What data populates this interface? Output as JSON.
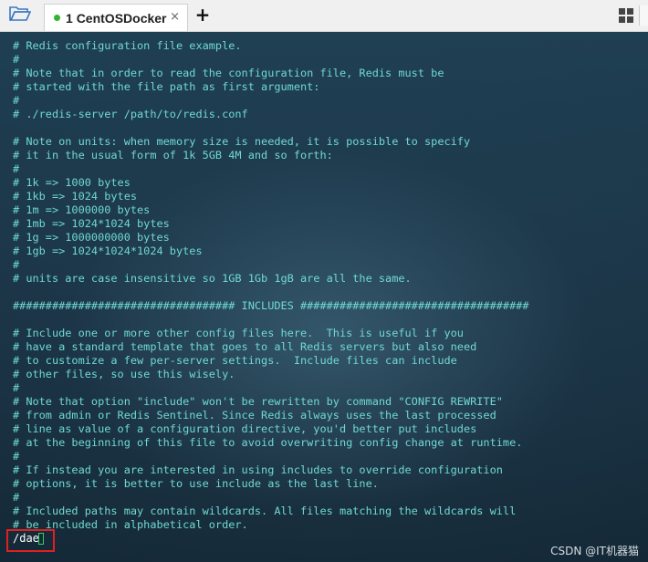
{
  "tabbar": {
    "folder_icon": "folder-open-icon",
    "tab": {
      "index": "1",
      "title": "CentOSDocker",
      "status_color": "#2fb52f"
    },
    "close_glyph": "×",
    "add_glyph": "+",
    "layout_icon": "grid-layout-icon"
  },
  "terminal": {
    "text_color": "#6fd9d2",
    "lines": [
      "# Redis configuration file example.",
      "#",
      "# Note that in order to read the configuration file, Redis must be",
      "# started with the file path as first argument:",
      "#",
      "# ./redis-server /path/to/redis.conf",
      "",
      "# Note on units: when memory size is needed, it is possible to specify",
      "# it in the usual form of 1k 5GB 4M and so forth:",
      "#",
      "# 1k => 1000 bytes",
      "# 1kb => 1024 bytes",
      "# 1m => 1000000 bytes",
      "# 1mb => 1024*1024 bytes",
      "# 1g => 1000000000 bytes",
      "# 1gb => 1024*1024*1024 bytes",
      "#",
      "# units are case insensitive so 1GB 1Gb 1gB are all the same.",
      "",
      "################################## INCLUDES ###################################",
      "",
      "# Include one or more other config files here.  This is useful if you",
      "# have a standard template that goes to all Redis servers but also need",
      "# to customize a few per-server settings.  Include files can include",
      "# other files, so use this wisely.",
      "#",
      "# Note that option \"include\" won't be rewritten by command \"CONFIG REWRITE\"",
      "# from admin or Redis Sentinel. Since Redis always uses the last processed",
      "# line as value of a configuration directive, you'd better put includes",
      "# at the beginning of this file to avoid overwriting config change at runtime.",
      "#",
      "# If instead you are interested in using includes to override configuration",
      "# options, it is better to use include as the last line.",
      "#",
      "# Included paths may contain wildcards. All files matching the wildcards will",
      "# be included in alphabetical order."
    ],
    "command_input": "/dae",
    "highlight_color": "#e02020",
    "cursor_color": "#2fd15a"
  },
  "watermark": "CSDN @IT机器猫"
}
